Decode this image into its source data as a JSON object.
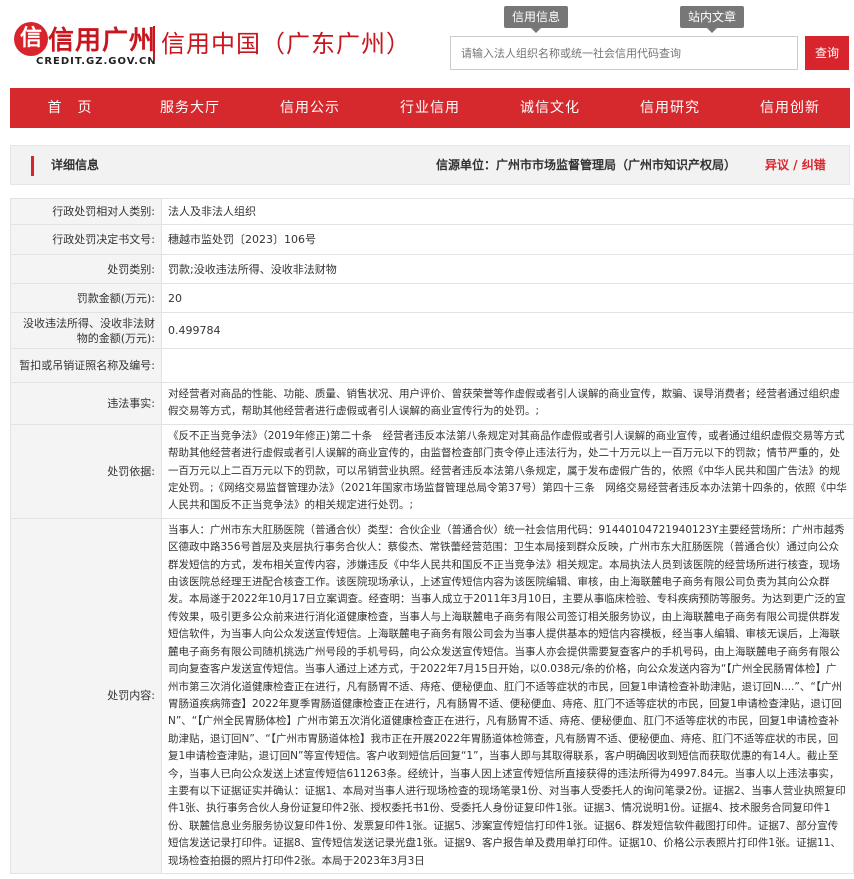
{
  "header": {
    "logo_text": "信用广州",
    "logo_sub": "CREDIT.GZ.GOV.CN",
    "site_title": "信用中国（广东广州）",
    "tab_info": "信用信息",
    "tab_site": "站内文章",
    "search_placeholder": "请输入法人组织名称或统一社会信用代码查询",
    "search_button": "查询"
  },
  "nav": [
    "首　页",
    "服务大厅",
    "信用公示",
    "行业信用",
    "诚信文化",
    "信用研究",
    "信用创新"
  ],
  "info_bar": {
    "title": "详细信息",
    "source": "信源单位：广州市市场监督管理局（广州市知识产权局）",
    "link": "异议 / 纠错"
  },
  "details": [
    {
      "label": "行政处罚相对人类别:",
      "value": "法人及非法人组织"
    },
    {
      "label": "行政处罚决定书文号:",
      "value": "穗越市监处罚〔2023〕106号"
    },
    {
      "label": "处罚类别:",
      "value": "罚款;没收违法所得、没收非法财物"
    },
    {
      "label": "罚款金额(万元):",
      "value": "20"
    },
    {
      "label": "没收违法所得、没收非法财物的金额(万元):",
      "value": "0.499784"
    },
    {
      "label": "暂扣或吊销证照名称及编号:",
      "value": ""
    },
    {
      "label": "违法事实:",
      "value": "对经营者对商品的性能、功能、质量、销售状况、用户评价、曾获荣誉等作虚假或者引人误解的商业宣传，欺骗、误导消费者；经营者通过组织虚假交易等方式，帮助其他经营者进行虚假或者引人误解的商业宣传行为的处罚。;"
    },
    {
      "label": "处罚依据:",
      "value": "《反不正当竞争法》（2019年修正)第二十条　经营者违反本法第八条规定对其商品作虚假或者引人误解的商业宣传，或者通过组织虚假交易等方式帮助其他经营者进行虚假或者引人误解的商业宣传的，由监督检查部门责令停止违法行为，处二十万元以上一百万元以下的罚款；情节严重的，处一百万元以上二百万元以下的罚款，可以吊销营业执照。经营者违反本法第八条规定，属于发布虚假广告的，依照《中华人民共和国广告法》的规定处罚。;《网络交易监督管理办法》（2021年国家市场监督管理总局令第37号）第四十三条　网络交易经营者违反本办法第十四条的，依照《中华人民共和国反不正当竞争法》的相关规定进行处罚。;"
    },
    {
      "label": "处罚内容:",
      "value": "当事人：广州市东大肛肠医院（普通合伙）类型：合伙企业（普通合伙）统一社会信用代码：91440104721940123Y主要经营场所：广州市越秀区德政中路356号首层及夹层执行事务合伙人：蔡俊杰、常铁蕾经营范围：卫生本局接到群众反映，广州市东大肛肠医院（普通合伙）通过向公众群发短信的方式，发布相关宣传内容，涉嫌违反《中华人民共和国反不正当竞争法》相关规定。本局执法人员到该医院的经营场所进行核查，现场由该医院总经理王进配合核查工作。该医院现场承认，上述宣传短信内容为该医院编辑、审核，由上海联麓电子商务有限公司负责为其向公众群发。本局遂于2022年10月17日立案调查。经查明：当事人成立于2011年3月10日，主要从事临床检验、专科疾病预防等服务。为达到更广泛的宣传效果，吸引更多公众前来进行消化道健康检查，当事人与上海联麓电子商务有限公司签订相关服务协议，由上海联麓电子商务有限公司提供群发短信软件，为当事人向公众发送宣传短信。上海联麓电子商务有限公司会为当事人提供基本的短信内容模板，经当事人编辑、审核无误后，上海联麓电子商务有限公司随机挑选广州号段的手机号码，向公众发送宣传短信。当事人亦会提供需要复查客户的手机号码，由上海联麓电子商务有限公司向复查客户发送宣传短信。当事人通过上述方式，于2022年7月15日开始，以0.038元/条的价格，向公众发送内容为“【广州全民肠胃体检】广州市第三次消化道健康检查正在进行，凡有肠胃不适、痔疮、便秘便血、肛门不适等症状的市民，回复1申请检查补助津贴，退订回N....”、“【广州胃肠道疾病筛查】2022年夏季胃肠道健康检查正在进行，凡有肠胃不适、便秘便血、痔疮、肛门不适等症状的市民，回复1申请检查津贴，退订回N”、“【广州全民胃肠体检】广州市第五次消化道健康检查正在进行，凡有肠胃不适、痔疮、便秘便血、肛门不适等症状的市民，回复1申请检查补助津贴，退订回N”、“【广州市胃肠道体检】我市正在开展2022年胃肠道体检筛查，凡有肠胃不适、便秘便血、痔疮、肛门不适等症状的市民，回复1申请检查津贴，退订回N”等宣传短信。客户收到短信后回复“1”，当事人即与其取得联系，客户明确因收到短信而获取优惠的有14人。截止至今，当事人已向公众发送上述宣传短信611263条。经统计，当事人因上述宣传短信所直接获得的违法所得为4997.84元。当事人以上违法事实，主要有以下证据证实并确认：证据1、本局对当事人进行现场检查的现场笔录1份、对当事人受委托人的询问笔录2份。证据2、当事人营业执照复印件1张、执行事务合伙人身份证复印件2张、授权委托书1份、受委托人身份证复印件1张。证据3、情况说明1份。证据4、技术服务合同复印件1份、联麓信息业务服务协议复印件1份、发票复印件1张。证据5、涉案宣传短信打印件1张。证据6、群发短信软件截图打印件。证据7、部分宣传短信发送记录打印件。证据8、宣传短信发送记录光盘1张。证据9、客户报告单及费用单打印件。证据10、价格公示表照片打印件1张。证据11、现场检查拍摄的照片打印件2张。本局于2023年3月3日"
    }
  ]
}
